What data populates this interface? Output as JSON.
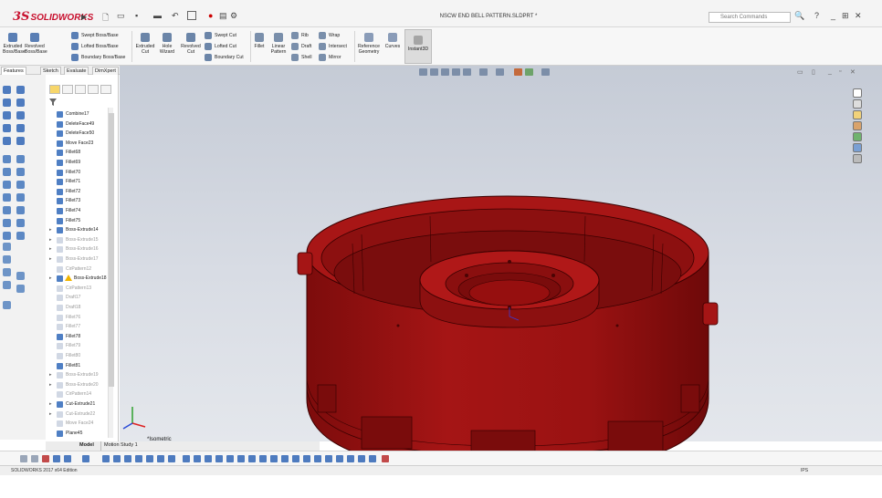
{
  "app": {
    "logo_text": "SOLIDWORKS",
    "logo_mark": "3S",
    "document_title": "NSCW END BELL PATTERN.SLDPRT *"
  },
  "search": {
    "placeholder": "Search Commands"
  },
  "window_controls": {
    "help": "?",
    "minimize": "_",
    "restore": "⊞",
    "close": "✕"
  },
  "ribbon": {
    "extruded_boss": "Extruded\nBoss/Base",
    "revolved_boss": "Revolved\nBoss/Base",
    "swept_boss": "Swept Boss/Base",
    "lofted_boss": "Lofted Boss/Base",
    "boundary_boss": "Boundary Boss/Base",
    "extruded_cut": "Extruded\nCut",
    "hole_wizard": "Hole\nWizard",
    "revolved_cut": "Revolved\nCut",
    "swept_cut": "Swept Cut",
    "lofted_cut": "Lofted Cut",
    "boundary_cut": "Boundary Cut",
    "fillet": "Fillet",
    "linear_pattern": "Linear\nPattern",
    "rib": "Rib",
    "draft": "Draft",
    "shell": "Shell",
    "wrap": "Wrap",
    "intersect": "Intersect",
    "mirror": "Mirror",
    "reference_geometry": "Reference\nGeometry",
    "curves": "Curves",
    "instant3d": "Instant3D"
  },
  "command_tabs": [
    "Features",
    "Sketch",
    "Evaluate",
    "DimXpert"
  ],
  "tree_items": [
    {
      "label": "Combine17",
      "state": "normal",
      "arrow": ""
    },
    {
      "label": "DeleteFace49",
      "state": "normal",
      "arrow": ""
    },
    {
      "label": "DeleteFace50",
      "state": "normal",
      "arrow": ""
    },
    {
      "label": "Move Face23",
      "state": "normal",
      "arrow": ""
    },
    {
      "label": "Fillet68",
      "state": "normal",
      "arrow": ""
    },
    {
      "label": "Fillet69",
      "state": "normal",
      "arrow": ""
    },
    {
      "label": "Fillet70",
      "state": "normal",
      "arrow": ""
    },
    {
      "label": "Fillet71",
      "state": "normal",
      "arrow": ""
    },
    {
      "label": "Fillet72",
      "state": "normal",
      "arrow": ""
    },
    {
      "label": "Fillet73",
      "state": "normal",
      "arrow": ""
    },
    {
      "label": "Fillet74",
      "state": "normal",
      "arrow": ""
    },
    {
      "label": "Fillet75",
      "state": "normal",
      "arrow": ""
    },
    {
      "label": "Boss-Extrude14",
      "state": "normal",
      "arrow": "▸"
    },
    {
      "label": "Boss-Extrude15",
      "state": "suppressed",
      "arrow": "▸"
    },
    {
      "label": "Boss-Extrude16",
      "state": "suppressed",
      "arrow": "▸"
    },
    {
      "label": "Boss-Extrude17",
      "state": "suppressed",
      "arrow": "▸"
    },
    {
      "label": "CirPattern12",
      "state": "suppressed",
      "arrow": ""
    },
    {
      "label": "Boss-Extrude18",
      "state": "warning",
      "arrow": "▸"
    },
    {
      "label": "CirPattern13",
      "state": "suppressed",
      "arrow": ""
    },
    {
      "label": "Draft17",
      "state": "suppressed",
      "arrow": ""
    },
    {
      "label": "Draft18",
      "state": "suppressed",
      "arrow": ""
    },
    {
      "label": "Fillet76",
      "state": "suppressed",
      "arrow": ""
    },
    {
      "label": "Fillet77",
      "state": "suppressed",
      "arrow": ""
    },
    {
      "label": "Fillet78",
      "state": "normal",
      "arrow": ""
    },
    {
      "label": "Fillet79",
      "state": "suppressed",
      "arrow": ""
    },
    {
      "label": "Fillet80",
      "state": "suppressed",
      "arrow": ""
    },
    {
      "label": "Fillet81",
      "state": "normal",
      "arrow": ""
    },
    {
      "label": "Boss-Extrude19",
      "state": "suppressed",
      "arrow": "▸"
    },
    {
      "label": "Boss-Extrude20",
      "state": "suppressed",
      "arrow": "▸"
    },
    {
      "label": "CirPattern14",
      "state": "suppressed",
      "arrow": ""
    },
    {
      "label": "Cut-Extrude21",
      "state": "normal",
      "arrow": "▸"
    },
    {
      "label": "Cut-Extrude22",
      "state": "suppressed",
      "arrow": "▸"
    },
    {
      "label": "Move Face24",
      "state": "suppressed",
      "arrow": ""
    },
    {
      "label": "Plane45",
      "state": "normal",
      "arrow": ""
    }
  ],
  "view": {
    "orientation": "*Isometric"
  },
  "bottom_tabs": [
    "Model",
    "Motion Study 1"
  ],
  "status": {
    "edition": "SOLIDWORKS 2017 x64 Edition",
    "units": "IPS"
  },
  "colors": {
    "model": "#a01414",
    "model_edge": "#3a0000",
    "accent": "#c8102e"
  }
}
